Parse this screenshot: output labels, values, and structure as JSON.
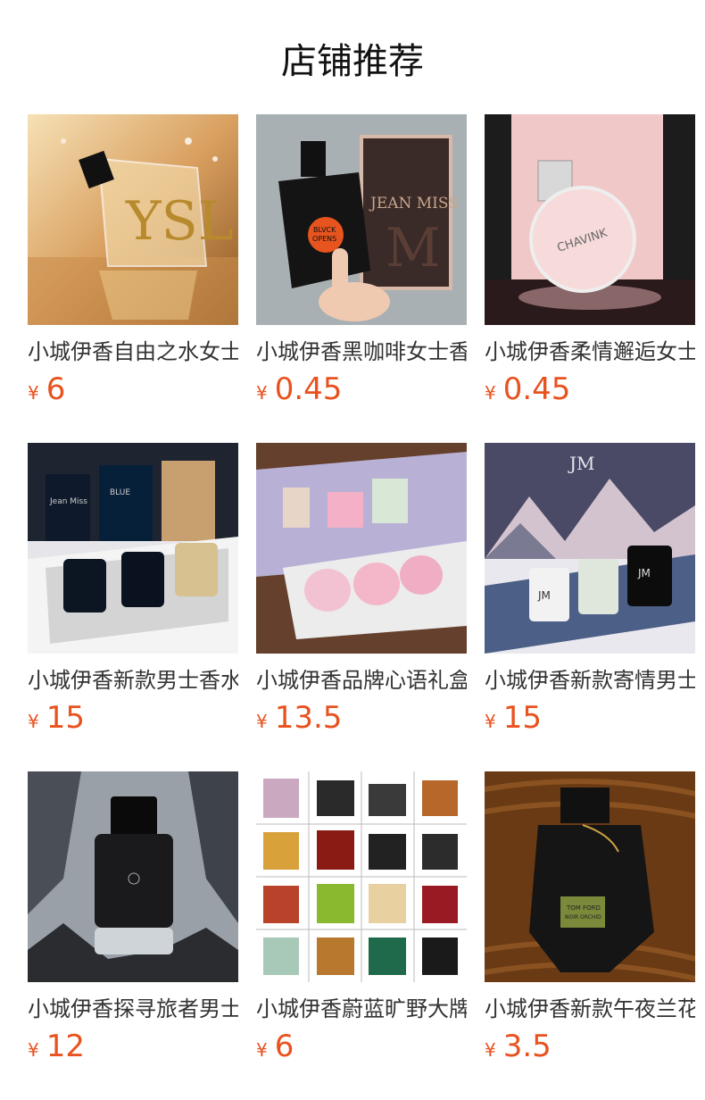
{
  "header": {
    "title": "店铺推荐"
  },
  "currency_symbol": "¥",
  "products": [
    {
      "name": "小城伊香自由之水女士香水",
      "price": "6",
      "image": "amber-bottle-reflection"
    },
    {
      "name": "小城伊香黑咖啡女士香水",
      "price": "0.45",
      "image": "black-bottle-hand"
    },
    {
      "name": "小城伊香柔情邂逅女士香水",
      "price": "0.45",
      "image": "pink-round-bottle"
    },
    {
      "name": "小城伊香新款男士香水礼盒",
      "price": "15",
      "image": "mens-gift-box-blue"
    },
    {
      "name": "小城伊香品牌心语礼盒香水",
      "price": "13.5",
      "image": "pink-gift-box"
    },
    {
      "name": "小城伊香新款寄情男士香水",
      "price": "15",
      "image": "mountain-gift-box"
    },
    {
      "name": "小城伊香探寻旅者男士香水",
      "price": "12",
      "image": "black-explorer-bottle"
    },
    {
      "name": "小城伊香蔚蓝旷野大牌香水",
      "price": "6",
      "image": "perfume-collage-grid"
    },
    {
      "name": "小城伊香新款午夜兰花香水",
      "price": "3.5",
      "image": "black-orchid-bottle"
    }
  ]
}
